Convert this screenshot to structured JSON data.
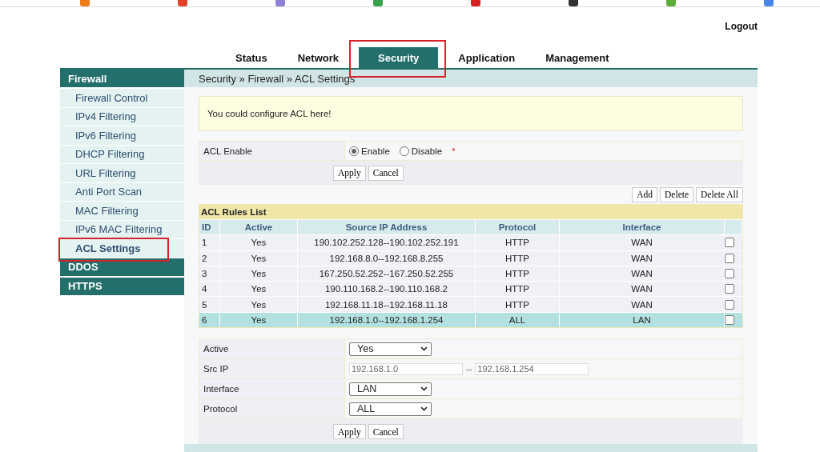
{
  "logout": "Logout",
  "tabs": [
    {
      "label": "Status",
      "selected": false,
      "highlighted": false
    },
    {
      "label": "Network",
      "selected": false,
      "highlighted": false
    },
    {
      "label": "Security",
      "selected": true,
      "highlighted": true
    },
    {
      "label": "Application",
      "selected": false,
      "highlighted": false
    },
    {
      "label": "Management",
      "selected": false,
      "highlighted": false
    }
  ],
  "sidebar": {
    "groups": [
      {
        "label": "Firewall",
        "expanded": true,
        "items": [
          {
            "label": "Firewall Control",
            "selected": false,
            "highlighted": false
          },
          {
            "label": "IPv4 Filtering",
            "selected": false,
            "highlighted": false
          },
          {
            "label": "IPv6 Filtering",
            "selected": false,
            "highlighted": false
          },
          {
            "label": "DHCP Filtering",
            "selected": false,
            "highlighted": false
          },
          {
            "label": "URL Filtering",
            "selected": false,
            "highlighted": false
          },
          {
            "label": "Anti Port Scan",
            "selected": false,
            "highlighted": false
          },
          {
            "label": "MAC Filtering",
            "selected": false,
            "highlighted": false
          },
          {
            "label": "IPv6 MAC Filtering",
            "selected": false,
            "highlighted": false
          },
          {
            "label": "ACL Settings",
            "selected": true,
            "highlighted": true
          }
        ]
      },
      {
        "label": "DDOS",
        "expanded": false
      },
      {
        "label": "HTTPS",
        "expanded": false
      }
    ]
  },
  "breadcrumb": "Security » Firewall » ACL Settings",
  "notice": "You could configure ACL here!",
  "acl_enable": {
    "label": "ACL Enable",
    "options": [
      {
        "label": "Enable",
        "selected": true
      },
      {
        "label": "Disable",
        "selected": false
      }
    ],
    "required_mark": "*"
  },
  "enable_buttons": [
    "Apply",
    "Cancel"
  ],
  "list_buttons": [
    "Add",
    "Delete",
    "Delete All"
  ],
  "rules": {
    "title": "ACL Rules List",
    "columns": [
      "ID",
      "Active",
      "Source IP Address",
      "Protocol",
      "Interface"
    ],
    "rows": [
      {
        "cells": [
          "1",
          "Yes",
          "190.102.252.128--190.102.252.191",
          "HTTP",
          "WAN"
        ],
        "selected": false,
        "checked": false
      },
      {
        "cells": [
          "2",
          "Yes",
          "192.168.8.0--192.168.8.255",
          "HTTP",
          "WAN"
        ],
        "selected": false,
        "checked": false
      },
      {
        "cells": [
          "3",
          "Yes",
          "167.250.52.252--167.250.52.255",
          "HTTP",
          "WAN"
        ],
        "selected": false,
        "checked": false
      },
      {
        "cells": [
          "4",
          "Yes",
          "190.110.168.2--190.110.168.2",
          "HTTP",
          "WAN"
        ],
        "selected": false,
        "checked": false
      },
      {
        "cells": [
          "5",
          "Yes",
          "192.168.11.18--192.168.11.18",
          "HTTP",
          "WAN"
        ],
        "selected": false,
        "checked": false
      },
      {
        "cells": [
          "6",
          "Yes",
          "192.168.1.0--192.168.1.254",
          "ALL",
          "LAN"
        ],
        "selected": true,
        "checked": false
      }
    ]
  },
  "form": {
    "rows": [
      {
        "kind": "select",
        "label": "Active",
        "value": "Yes"
      },
      {
        "kind": "range",
        "label": "Src IP",
        "from": "192.168.1.0",
        "separator": "--",
        "to": "192.168.1.254"
      },
      {
        "kind": "select",
        "label": "Interface",
        "value": "LAN"
      },
      {
        "kind": "select",
        "label": "Protocol",
        "value": "ALL"
      }
    ],
    "buttons": [
      "Apply",
      "Cancel"
    ]
  }
}
